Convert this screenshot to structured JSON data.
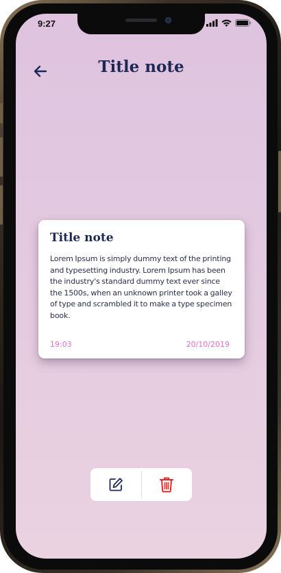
{
  "status_bar": {
    "time": "9:27"
  },
  "header": {
    "title": "Title note"
  },
  "note": {
    "title": "Title note",
    "body": "Lorem Ipsum is simply dummy text of the printing and typesetting industry. Lorem Ipsum has been the industry's standard dummy text ever since the 1500s, when an unknown printer took a galley of type and scrambled it to make a type specimen book.",
    "time": "19:03",
    "date": "20/10/2019"
  },
  "colors": {
    "title": "#1e2857",
    "accent": "#e86ad0",
    "delete": "#e02a2a",
    "background": "#e3cbe0"
  },
  "icons": {
    "back": "arrow-left-icon",
    "edit": "edit-icon",
    "delete": "trash-icon"
  }
}
